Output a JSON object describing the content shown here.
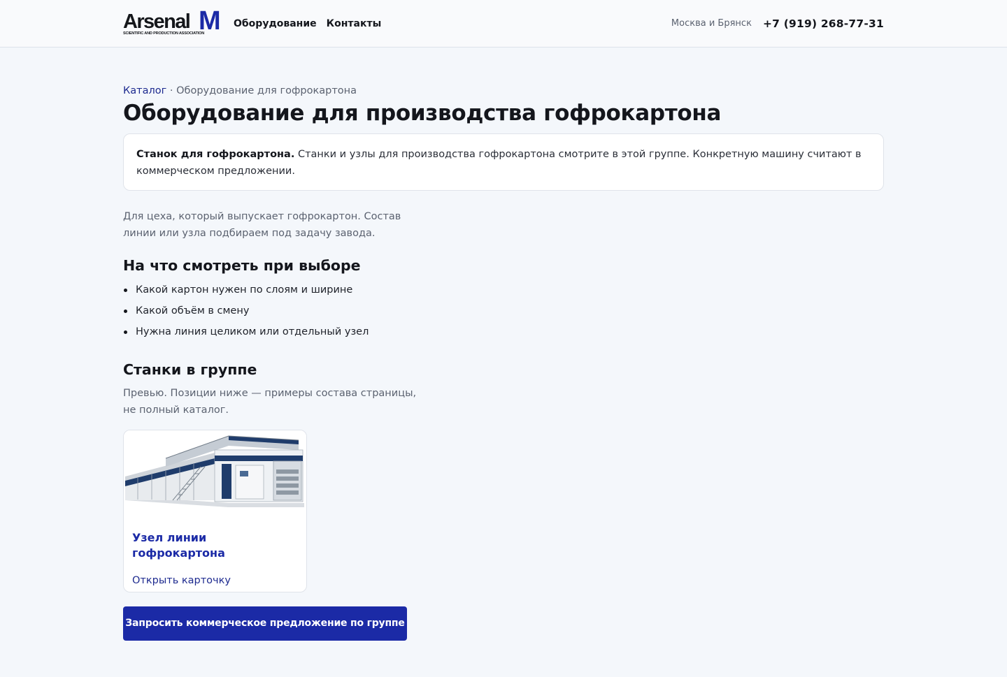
{
  "header": {
    "logo_word": "Arsenal",
    "logo_letter": "M",
    "logo_sub": "SCIENTIFIC AND PRODUCTION ASSOCIATION",
    "nav": [
      {
        "label": "Оборудование"
      },
      {
        "label": "Контакты"
      }
    ],
    "city": "Москва и Брянск",
    "phone": "+7 (919) 268-77-31"
  },
  "breadcrumb": {
    "root": "Каталог",
    "separator": " · ",
    "current": "Оборудование для гофрокартона"
  },
  "page_title": "Оборудование для производства гофрокартона",
  "notice": {
    "bold": "Станок для гофрокартона.",
    "text": " Станки и узлы для производства гофрокартона смотрите в этой группе. Конкретную машину считают в коммерческом предложении."
  },
  "lead": "Для цеха, который выпускает гофрокартон. Состав линии или узла подбираем под задачу завода.",
  "choose": {
    "heading": "На что смотреть при выборе",
    "items": [
      "Какой картон нужен по слоям и ширине",
      "Какой объём в смену",
      "Нужна линия целиком или отдельный узел"
    ]
  },
  "group": {
    "heading": "Станки в группе",
    "note": "Превью. Позиции ниже — примеры состава страницы, не полный каталог.",
    "cards": [
      {
        "title": "Узел линии гофрокартона",
        "link": "Открыть карточку"
      }
    ]
  },
  "cta_label": "Запросить коммерческое предложение по группе",
  "colors": {
    "brand_blue": "#1b2aa6",
    "link_blue": "#1d2a8f",
    "page_bg": "#f4f7fb"
  }
}
